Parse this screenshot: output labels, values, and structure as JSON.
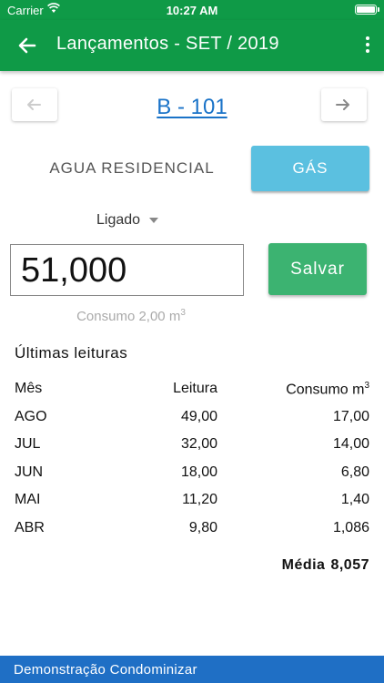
{
  "status_bar": {
    "carrier": "Carrier",
    "time": "10:27 AM"
  },
  "app_bar": {
    "title": "Lançamentos - SET / 2019"
  },
  "unit": {
    "name": "B - 101"
  },
  "tabs": [
    {
      "label": "AGUA RESIDENCIAL",
      "selected": false
    },
    {
      "label": "GÁS",
      "selected": true
    }
  ],
  "status_select": {
    "value": "Ligado"
  },
  "reading": {
    "value": "51,000",
    "save_label": "Salvar"
  },
  "consumo": {
    "text": "Consumo 2,00 m",
    "unit_sup": "3"
  },
  "history": {
    "title": "Últimas leituras",
    "headers": {
      "month": "Mês",
      "reading": "Leitura",
      "consumption": "Consumo m",
      "consumption_sup": "3"
    },
    "rows": [
      {
        "month": "AGO",
        "reading": "49,00",
        "consumption": "17,00"
      },
      {
        "month": "JUL",
        "reading": "32,00",
        "consumption": "14,00"
      },
      {
        "month": "JUN",
        "reading": "18,00",
        "consumption": "6,80"
      },
      {
        "month": "MAI",
        "reading": "11,20",
        "consumption": "1,40"
      },
      {
        "month": "ABR",
        "reading": "9,80",
        "consumption": "1,086"
      }
    ],
    "average_label": "Média",
    "average_value": "8,057"
  },
  "footer": {
    "text": "Demonstração Condominizar"
  },
  "colors": {
    "primary": "#0f9a47",
    "tab_selected": "#5bc0e0",
    "save": "#3cb371",
    "link": "#1a73c8",
    "footer": "#1f6fc5"
  }
}
